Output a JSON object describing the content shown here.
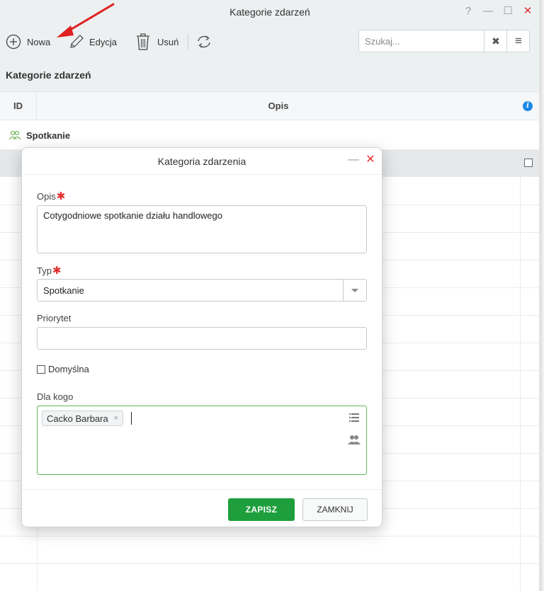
{
  "window": {
    "title": "Kategorie zdarzeń",
    "help": "?",
    "minimize": "—",
    "maximize": "☐",
    "close": "✕"
  },
  "toolbar": {
    "new_label": "Nowa",
    "edit_label": "Edycja",
    "delete_label": "Usuń",
    "search_placeholder": "Szukaj...",
    "clear_symbol": "✖",
    "menu_symbol": "≡"
  },
  "breadcrumb": "Kategorie zdarzeń",
  "grid": {
    "col_id": "ID",
    "col_opis": "Opis",
    "info_symbol": "i",
    "group_label": "Spotkanie"
  },
  "dialog": {
    "title": "Kategoria zdarzenia",
    "minimize": "—",
    "close": "✕",
    "opis_label": "Opis",
    "required_mark": "✱",
    "opis_value": "Cotygodniowe spotkanie działu handlowego",
    "typ_label": "Typ",
    "typ_value": "Spotkanie",
    "priorytet_label": "Priorytet",
    "priorytet_value": "",
    "domyslna_label": "Domyślna",
    "dla_kogo_label": "Dla kogo",
    "tags": [
      "Cacko Barbara"
    ],
    "tag_remove": "×",
    "save_label": "ZAPISZ",
    "close_label": "ZAMKNIJ"
  },
  "colors": {
    "accent_green": "#1e9e3c",
    "required_red": "#e03030",
    "info_blue": "#1e88e5",
    "annotation_arrow": "#e02020"
  }
}
